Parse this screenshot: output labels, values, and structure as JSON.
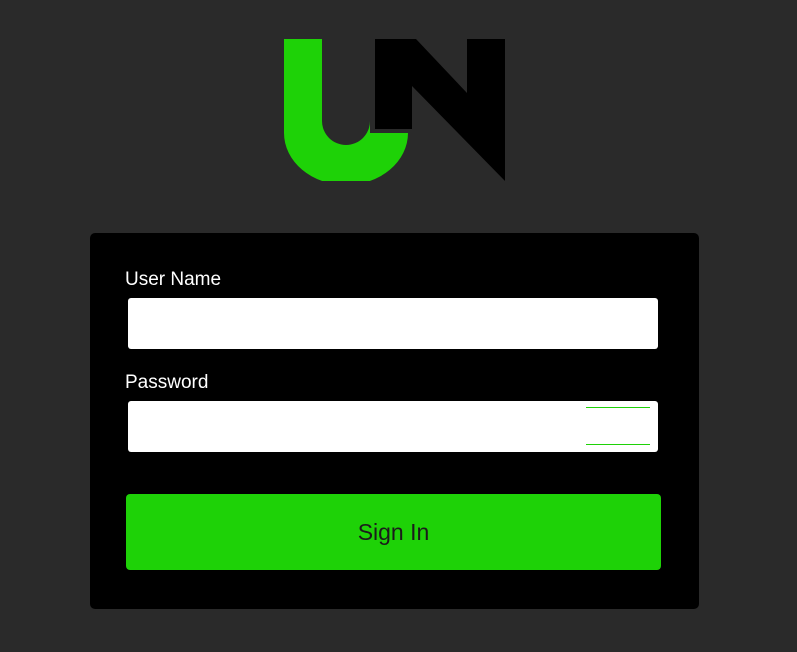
{
  "logo": {
    "icon": "un-logo-icon",
    "colors": {
      "u": "#1ed207",
      "n": "#000000"
    }
  },
  "form": {
    "username_label": "User Name",
    "username_value": "",
    "password_label": "Password",
    "password_value": "",
    "signin_label": "Sign In"
  },
  "colors": {
    "background": "#2a2a2a",
    "panel": "#000000",
    "accent": "#1ed207",
    "input": "#ffffff"
  }
}
